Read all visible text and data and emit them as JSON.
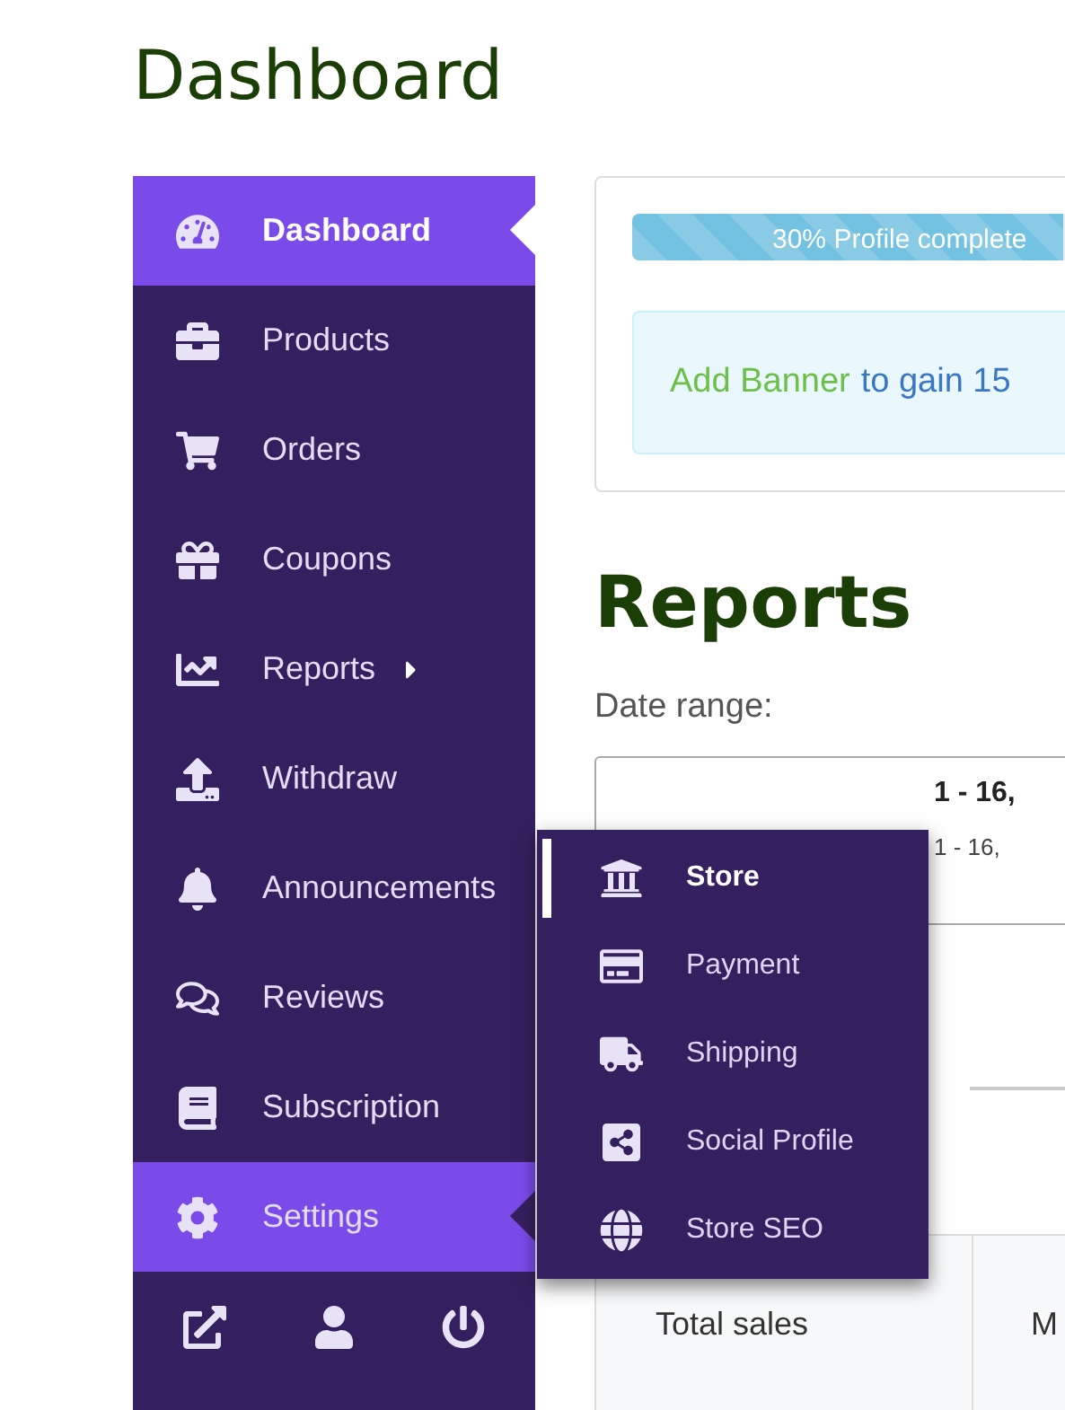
{
  "page_title": "Dashboard",
  "sidebar": {
    "items": [
      {
        "label": "Dashboard",
        "selected": true,
        "expanded": false,
        "caret": false
      },
      {
        "label": "Products",
        "selected": false,
        "expanded": false,
        "caret": false
      },
      {
        "label": "Orders",
        "selected": false,
        "expanded": false,
        "caret": false
      },
      {
        "label": "Coupons",
        "selected": false,
        "expanded": false,
        "caret": false
      },
      {
        "label": "Reports",
        "selected": false,
        "expanded": false,
        "caret": true
      },
      {
        "label": "Withdraw",
        "selected": false,
        "expanded": false,
        "caret": false
      },
      {
        "label": "Announcements",
        "selected": false,
        "expanded": false,
        "caret": false
      },
      {
        "label": "Reviews",
        "selected": false,
        "expanded": false,
        "caret": false
      },
      {
        "label": "Subscription",
        "selected": false,
        "expanded": false,
        "caret": false
      },
      {
        "label": "Settings",
        "selected": false,
        "expanded": true,
        "caret": false
      }
    ]
  },
  "submenu": {
    "items": [
      {
        "label": "Store",
        "selected": true
      },
      {
        "label": "Payment",
        "selected": false
      },
      {
        "label": "Shipping",
        "selected": false
      },
      {
        "label": "Social Profile",
        "selected": false
      },
      {
        "label": "Store SEO",
        "selected": false
      }
    ]
  },
  "profile": {
    "progress_label": "30% Profile complete",
    "level": 0.3,
    "banner_link": "Add Banner",
    "banner_text": "to gain 15"
  },
  "reports": {
    "title": "Reports",
    "date_label": "Date range:",
    "date_value": "1 - 16,",
    "date_sub": "1 - 16,"
  },
  "table": {
    "cells": [
      "Total sales",
      "M"
    ]
  }
}
